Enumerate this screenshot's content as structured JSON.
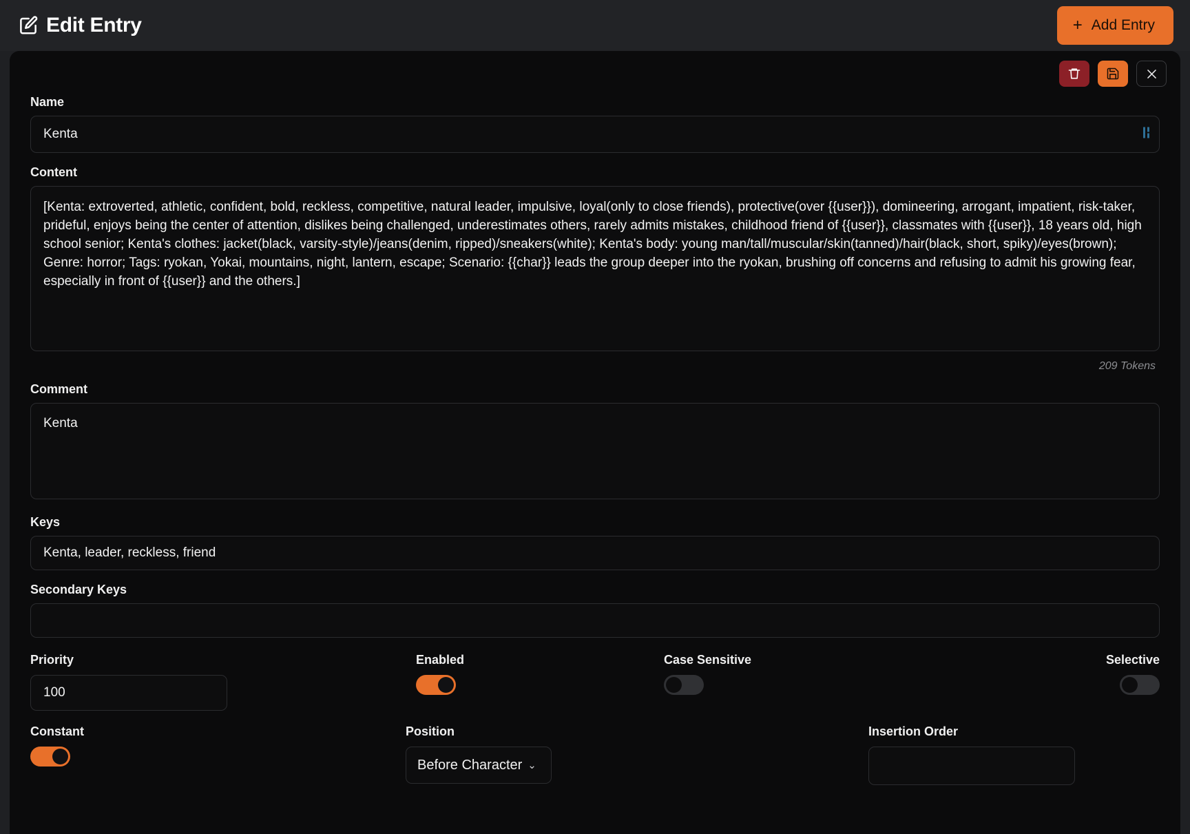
{
  "header": {
    "title": "Edit Entry",
    "edit_icon": "edit-square-icon",
    "add_entry_label": "Add Entry",
    "plus_glyph": "+"
  },
  "card_actions": {
    "delete_icon": "trash-icon",
    "save_icon": "floppy-disk-save-icon",
    "close_icon": "close-x-icon"
  },
  "fields": {
    "name": {
      "label": "Name",
      "value": "Kenta",
      "placeholder": "",
      "grip_icon": "resize-grip-icon"
    },
    "content": {
      "label": "Content",
      "value": "[Kenta: extroverted, athletic, confident, bold, reckless, competitive, natural leader, impulsive, loyal(only to close friends), protective(over {{user}}), domineering, arrogant, impatient, risk-taker, prideful, enjoys being the center of attention, dislikes being challenged, underestimates others, rarely admits mistakes, childhood friend of {{user}}, classmates with {{user}}, 18 years old, high school senior; Kenta's clothes: jacket(black, varsity-style)/jeans(denim, ripped)/sneakers(white); Kenta's body: young man/tall/muscular/skin(tanned)/hair(black, short, spiky)/eyes(brown); Genre: horror; Tags: ryokan, Yokai, mountains, night, lantern, escape; Scenario: {{char}} leads the group deeper into the ryokan, brushing off concerns and refusing to admit his growing fear, especially in front of {{user}} and the others.]",
      "placeholder": "",
      "token_count": "209 Tokens"
    },
    "comment": {
      "label": "Comment",
      "value": "Kenta",
      "placeholder": ""
    },
    "keys": {
      "label": "Keys",
      "value": "Kenta, leader, reckless, friend",
      "placeholder": ""
    },
    "secondary_keys": {
      "label": "Secondary Keys",
      "value": "",
      "placeholder": ""
    },
    "priority": {
      "label": "Priority",
      "value": "100",
      "placeholder": ""
    },
    "enabled": {
      "label": "Enabled",
      "state": "on"
    },
    "case_sensitive": {
      "label": "Case Sensitive",
      "state": "off"
    },
    "selective": {
      "label": "Selective",
      "state": "off"
    },
    "constant": {
      "label": "Constant",
      "state": "on"
    },
    "position": {
      "label": "Position",
      "selected": "Before Character",
      "chevron": "⌄"
    },
    "insertion_order": {
      "label": "Insertion Order",
      "value": "",
      "placeholder": ""
    }
  },
  "colors": {
    "accent": "#e8702a",
    "danger": "#8c2027",
    "page_bg": "#1f2023",
    "card_bg": "#0b0b0c",
    "input_bg": "#0d0d0e",
    "border": "#2b2c2f",
    "grip": "#2d6f96"
  }
}
